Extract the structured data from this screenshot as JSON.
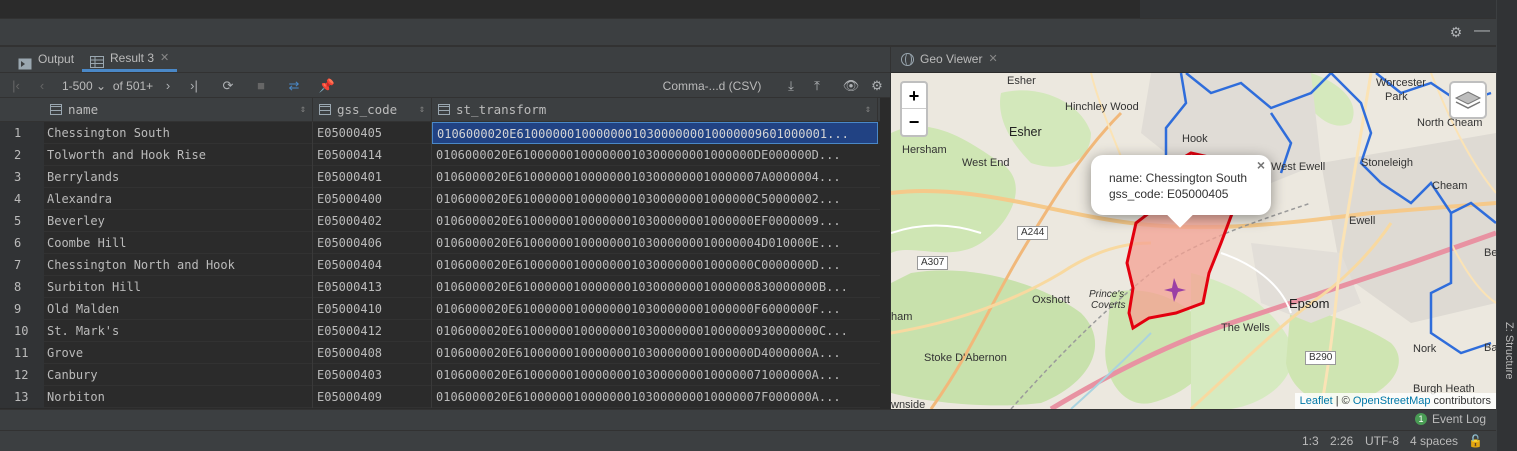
{
  "results_panel": {
    "tabs": [
      {
        "label": "Output"
      },
      {
        "label": "Result 3"
      }
    ],
    "pager": {
      "range": "1-500",
      "total": "of 501+"
    },
    "export_format": "Comma-...d (CSV)",
    "columns": [
      "name",
      "gss_code",
      "st_transform"
    ],
    "rows": [
      {
        "n": "1",
        "name": "Chessington South",
        "gss": "E05000405",
        "geom": "0106000020E6100000010000000103000000010000009601000001..."
      },
      {
        "n": "2",
        "name": "Tolworth and Hook Rise",
        "gss": "E05000414",
        "geom": "0106000020E610000001000000010300000001000000DE000000D..."
      },
      {
        "n": "3",
        "name": "Berrylands",
        "gss": "E05000401",
        "geom": "0106000020E6100000010000000103000000010000007A0000004..."
      },
      {
        "n": "4",
        "name": "Alexandra",
        "gss": "E05000400",
        "geom": "0106000020E610000001000000010300000001000000C50000002..."
      },
      {
        "n": "5",
        "name": "Beverley",
        "gss": "E05000402",
        "geom": "0106000020E610000001000000010300000001000000EF0000009..."
      },
      {
        "n": "6",
        "name": "Coombe Hill",
        "gss": "E05000406",
        "geom": "0106000020E6100000010000000103000000010000004D010000E..."
      },
      {
        "n": "7",
        "name": "Chessington North and Hook",
        "gss": "E05000404",
        "geom": "0106000020E610000001000000010300000001000000C0000000D..."
      },
      {
        "n": "8",
        "name": "Surbiton Hill",
        "gss": "E05000413",
        "geom": "0106000020E610000001000000010300000001000000830000000B..."
      },
      {
        "n": "9",
        "name": "Old Malden",
        "gss": "E05000410",
        "geom": "0106000020E610000001000000010300000001000000F6000000F..."
      },
      {
        "n": "10",
        "name": "St. Mark's",
        "gss": "E05000412",
        "geom": "0106000020E610000001000000010300000001000000930000000C..."
      },
      {
        "n": "11",
        "name": "Grove",
        "gss": "E05000408",
        "geom": "0106000020E610000001000000010300000001000000D4000000A..."
      },
      {
        "n": "12",
        "name": "Canbury",
        "gss": "E05000403",
        "geom": "0106000020E61000000100000001030000000100000071000000A..."
      },
      {
        "n": "13",
        "name": "Norbiton",
        "gss": "E05000409",
        "geom": "0106000020E6100000010000000103000000010000007F000000A..."
      }
    ]
  },
  "geo_viewer": {
    "tab_label": "Geo Viewer",
    "zoom_in": "+",
    "zoom_out": "−",
    "popup": {
      "line1": "name: Chessington South",
      "line2": "gss_code: E05000405",
      "close": "×"
    },
    "attribution": {
      "leaflet": "Leaflet",
      "sep": " | © ",
      "osm": "OpenStreetMap",
      "rest": " contributors"
    },
    "place_labels": [
      {
        "text": "Esher"
      },
      {
        "text": "Hinchley Wood"
      },
      {
        "text": "Worcester"
      },
      {
        "text": "Park"
      },
      {
        "text": "Hook"
      },
      {
        "text": "Esher"
      },
      {
        "text": "North Cheam"
      },
      {
        "text": "Hersham"
      },
      {
        "text": "West End"
      },
      {
        "text": "West Ewell"
      },
      {
        "text": "Stoneleigh"
      },
      {
        "text": "Cheam"
      },
      {
        "text": "Ewell"
      },
      {
        "text": "Oxshott"
      },
      {
        "text": "Prince's"
      },
      {
        "text": "Coverts"
      },
      {
        "text": "Epsom"
      },
      {
        "text": "The Wells"
      },
      {
        "text": "ham"
      },
      {
        "text": "Stoke D'Abernon"
      },
      {
        "text": "Nork"
      },
      {
        "text": "Burgh Heath"
      },
      {
        "text": "wnside"
      },
      {
        "text": "Ba"
      },
      {
        "text": "Be"
      }
    ],
    "road_labels": [
      "A244",
      "A307",
      "B290"
    ],
    "colors": {
      "polygon_fill": "#f4a193",
      "polygon_stroke": "#e3000f",
      "boundary": "#2f6ddb"
    }
  },
  "side_tab": "Z: Structure",
  "event_log": {
    "count": "1",
    "label": "Event Log"
  },
  "status": {
    "position": "1:3",
    "time": "2:26",
    "encoding": "UTF-8",
    "indent": "4 spaces"
  }
}
